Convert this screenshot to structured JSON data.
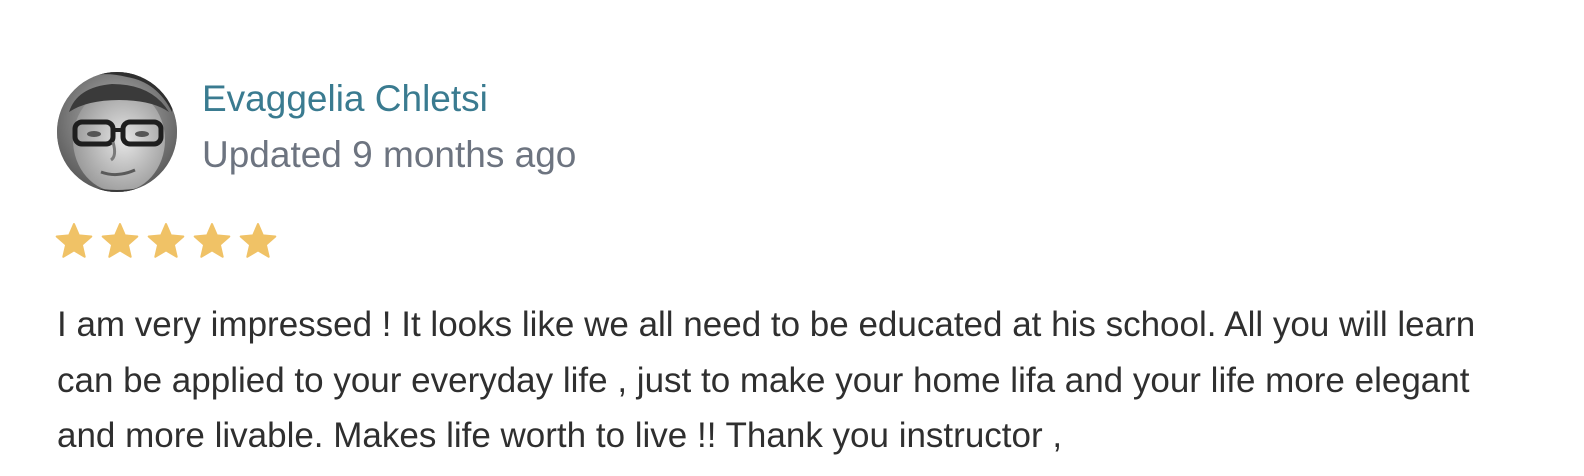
{
  "review": {
    "reviewer_name": "Evaggelia Chletsi",
    "meta": "Updated 9 months ago",
    "rating": 5,
    "rating_max": 5,
    "star_color": "#f0c266",
    "name_color": "#3a7b90",
    "body": "I am very impressed ! It looks like we all need to be educated at his school. All you will learn can be applied to your everyday life , just to make your home lifa and your life more elegant and more livable. Makes life worth to live !! Thank you instructor ,"
  }
}
